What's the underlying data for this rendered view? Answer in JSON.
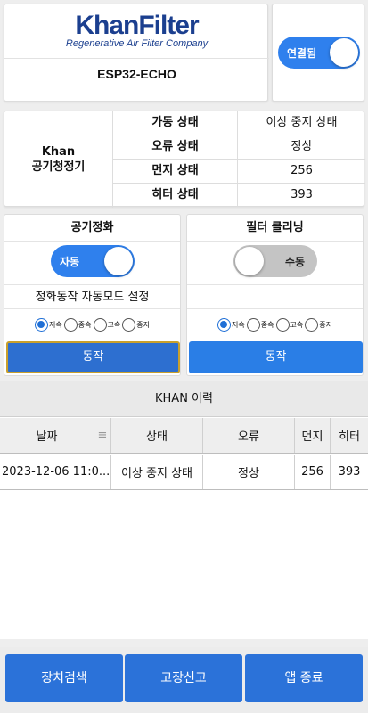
{
  "header": {
    "logo_text": "KhanFilter",
    "logo_tagline": "Regenerative Air Filter Company",
    "device_name": "ESP32-ECHO"
  },
  "connection": {
    "label": "연결됨",
    "on": true
  },
  "status": {
    "title_line1": "Khan",
    "title_line2": "공기청정기",
    "rows": [
      {
        "label": "가동 상태",
        "value": "이상 중지 상태"
      },
      {
        "label": "오류 상태",
        "value": "정상"
      },
      {
        "label": "먼지 상태",
        "value": "256"
      },
      {
        "label": "히터 상태",
        "value": "393"
      }
    ]
  },
  "air_panel": {
    "title": "공기정화",
    "toggle_label": "자동",
    "toggle_on": true,
    "description": "정화동작 자동모드 설정",
    "options": [
      "저속",
      "중속",
      "고속",
      "중지"
    ],
    "selected": "저속",
    "action_label": "동작"
  },
  "filter_panel": {
    "title": "필터 클리닝",
    "toggle_label": "수동",
    "toggle_on": false,
    "description": "",
    "options": [
      "저속",
      "중속",
      "고속",
      "중지"
    ],
    "selected": "저속",
    "action_label": "동작"
  },
  "history": {
    "title": "KHAN 이력",
    "columns": [
      "날짜",
      "상태",
      "오류",
      "먼지",
      "히터"
    ],
    "rows": [
      {
        "date": "2023-12-06 11:0...",
        "state": "이상 중지 상태",
        "error": "정상",
        "dust": "256",
        "heater": "393"
      }
    ]
  },
  "bottom_bar": {
    "device_search": "장치검색",
    "fault_report": "고장신고",
    "exit_app": "앱 종료"
  },
  "colors": {
    "brand": "#1b3f8f",
    "accent": "#2b72d9",
    "toggle_on": "#2f80ed",
    "toggle_off": "#c4c4c4",
    "focus_border": "#c9a02c"
  }
}
